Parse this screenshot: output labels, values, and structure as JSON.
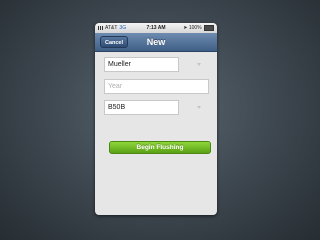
{
  "status_bar": {
    "carrier": "AT&T",
    "network": "3G",
    "time": "7:13 AM",
    "battery": "100%",
    "icons": [
      "signal-bars-icon",
      "location-arrow-icon",
      "battery-icon"
    ]
  },
  "nav": {
    "cancel_label": "Cancel",
    "title": "New"
  },
  "form": {
    "name_value": "Mueller",
    "year_placeholder": "Year",
    "code_value": "B50B",
    "submit_label": "Begin Flushing"
  },
  "colors": {
    "nav_bar": "#4f6f96",
    "submit_button": "#72bd25",
    "background": "#e6e6e6"
  }
}
